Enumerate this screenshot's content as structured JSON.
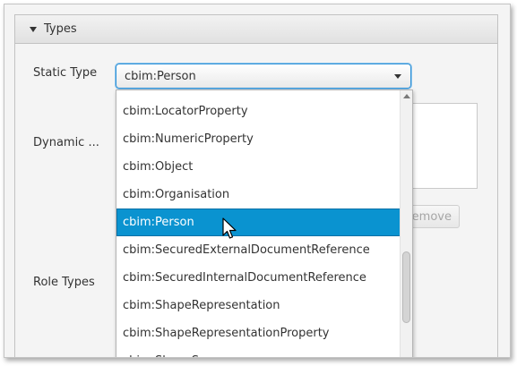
{
  "panel": {
    "title": "Types"
  },
  "form": {
    "static_type_label": "Static Type",
    "dynamic_label": "Dynamic ...",
    "role_types_label": "Role Types",
    "static_type_value": "cbim:Person",
    "remove_button_label": "Remove"
  },
  "dropdown": {
    "items": [
      "cbim:LocatorProperty",
      "cbim:NumericProperty",
      "cbim:Object",
      "cbim:Organisation",
      "cbim:Person",
      "cbim:SecuredExternalDocumentReference",
      "cbim:SecuredInternalDocumentReference",
      "cbim:ShapeRepresentation",
      "cbim:ShapeRepresentationProperty",
      "cbim:ShapeSource"
    ],
    "selected": "cbim:Person"
  },
  "colors": {
    "selection": "#0a93d0",
    "focus_border": "#2f92d8"
  },
  "icons": {
    "collapse": "triangle-down-icon",
    "combo_arrow": "chevron-down-icon",
    "scroll_up": "arrow-up-icon",
    "cursor": "mouse-pointer-icon"
  }
}
